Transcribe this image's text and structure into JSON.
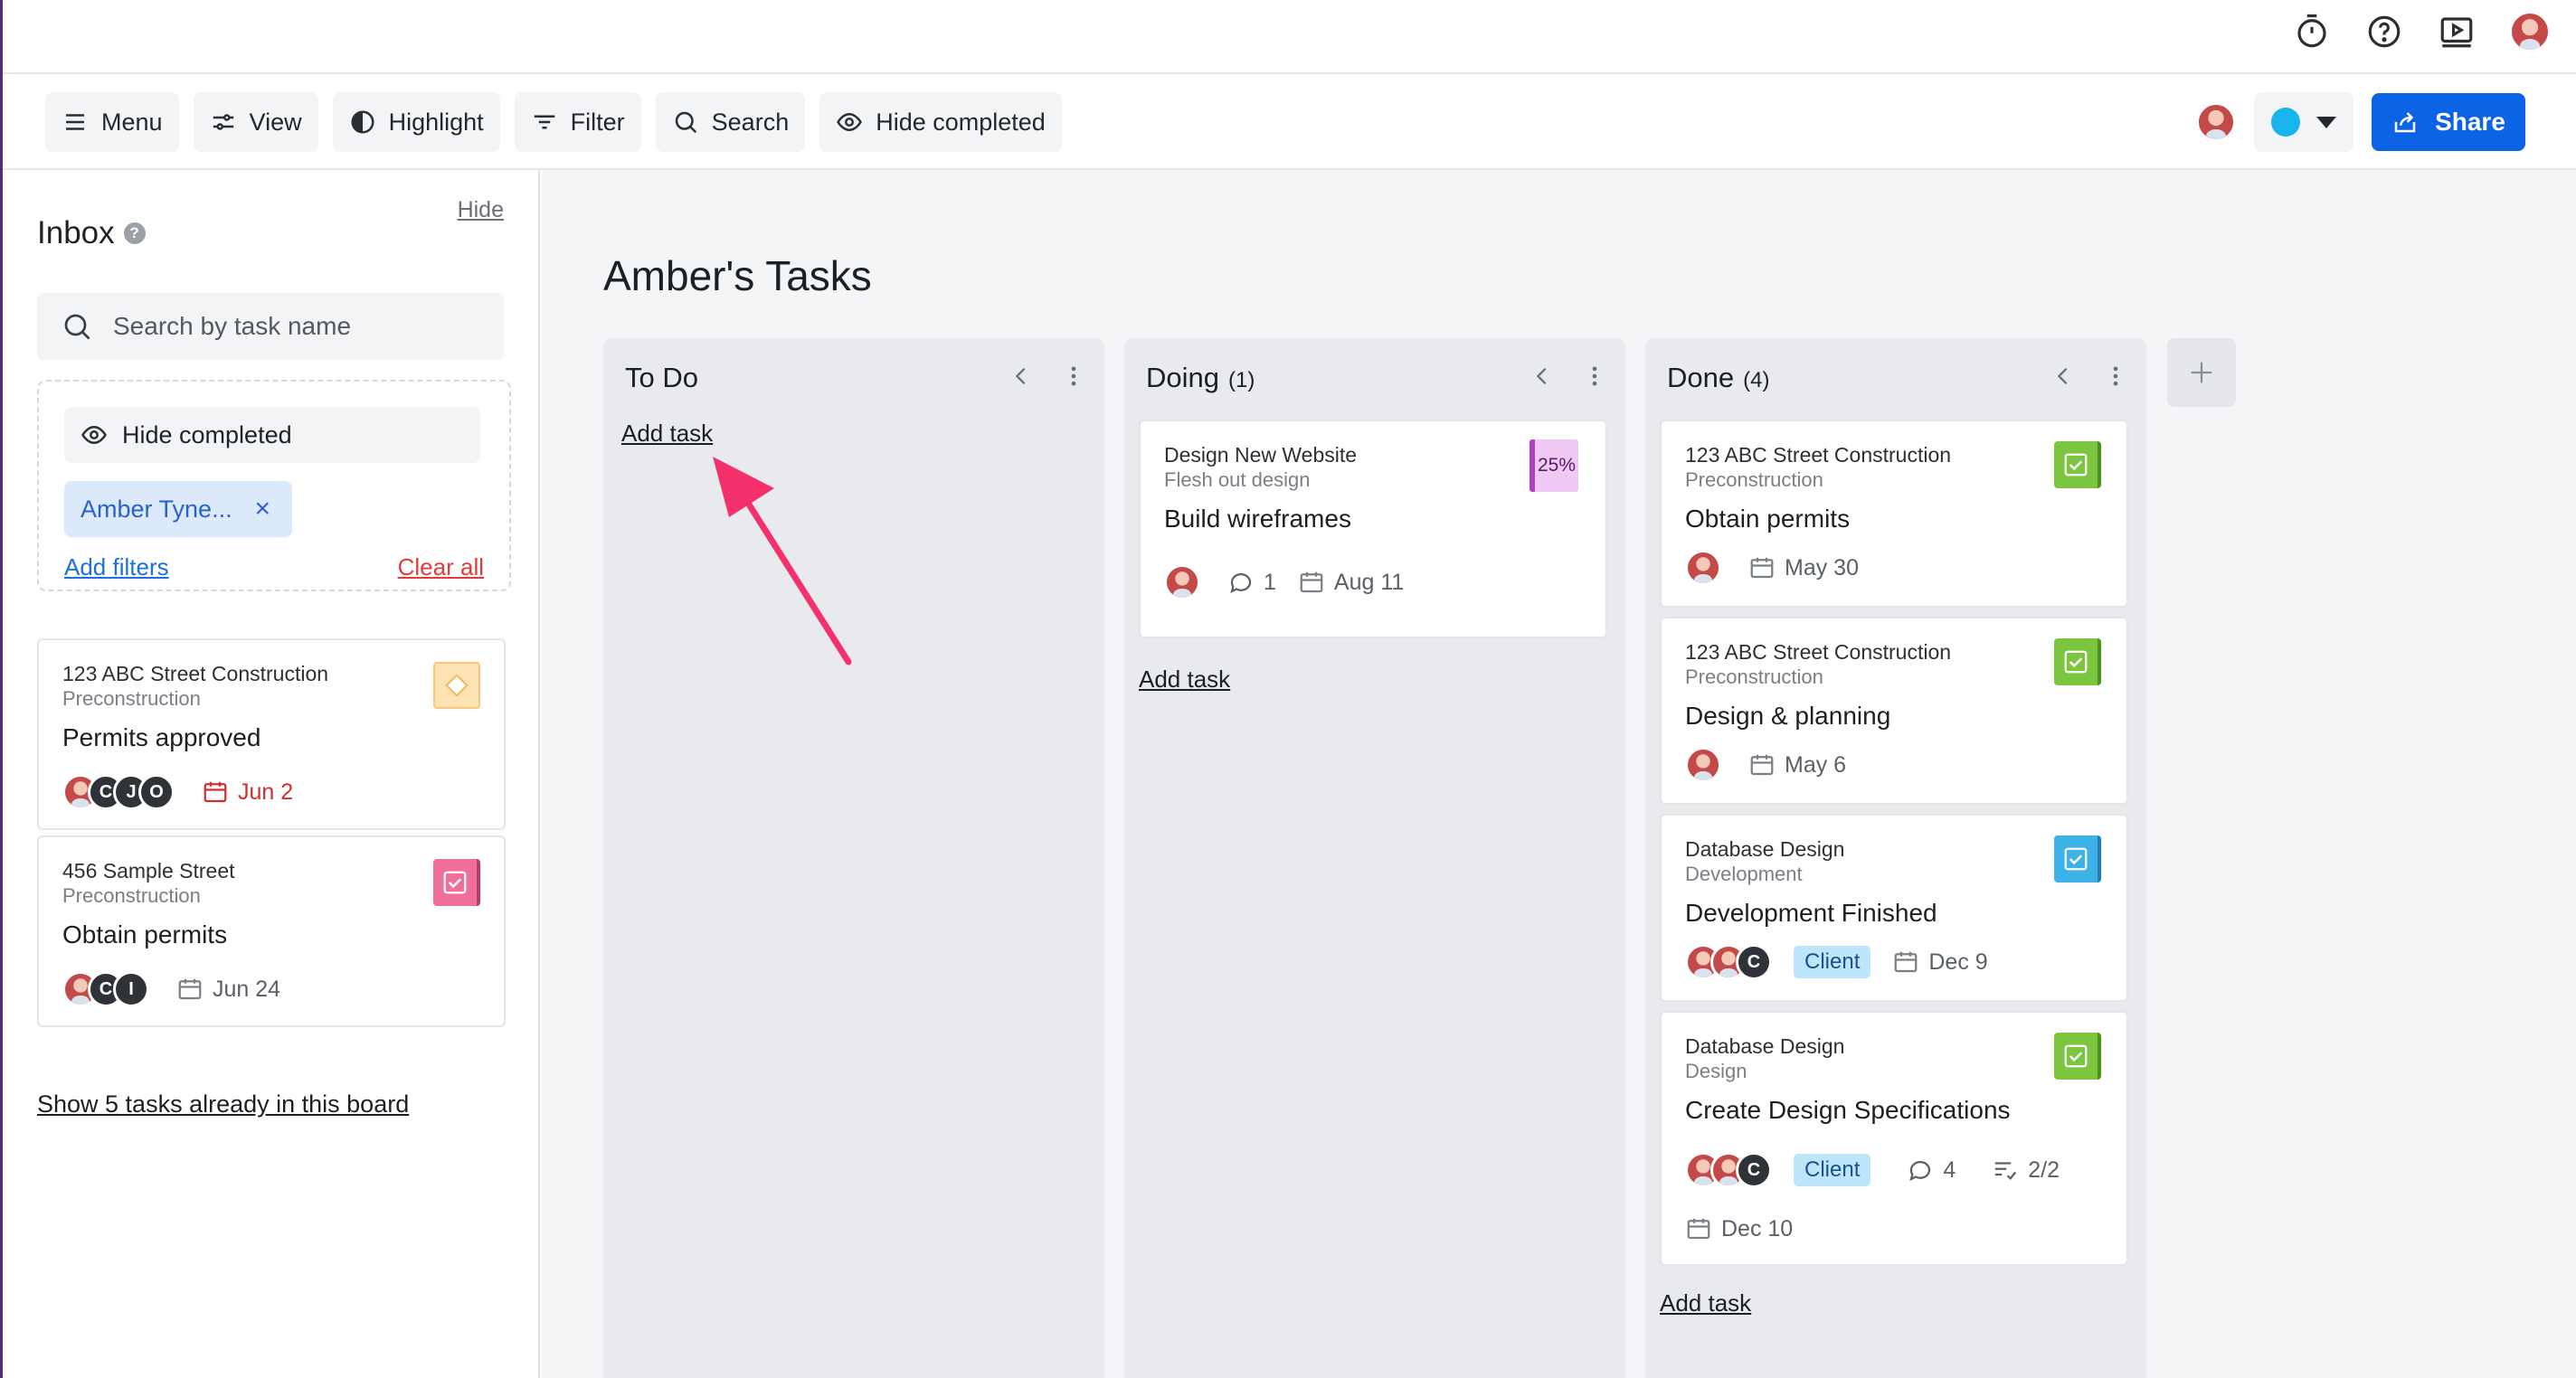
{
  "toolbar": {
    "menu": "Menu",
    "view": "View",
    "highlight": "Highlight",
    "filter": "Filter",
    "search": "Search",
    "hide_completed": "Hide completed",
    "share": "Share",
    "color_accent": "#18b4ee"
  },
  "sidebar": {
    "title": "Inbox",
    "help": "?",
    "hide": "Hide",
    "search_placeholder": "Search by task name",
    "hide_completed": "Hide completed",
    "filter_chip": "Amber Tyne...",
    "chip_close": "×",
    "add_filters": "Add filters",
    "clear_all": "Clear all",
    "cards": [
      {
        "project": "123 ABC Street Construction",
        "phase": "Preconstruction",
        "title": "Permits approved",
        "avatars": [
          "C",
          "J",
          "O"
        ],
        "date": "Jun 2",
        "date_color": "#d12f2f",
        "status": "milestone",
        "status_color": "#f8c97a"
      },
      {
        "project": "456 Sample Street",
        "phase": "Preconstruction",
        "title": "Obtain permits",
        "avatars": [
          "C",
          "I"
        ],
        "date": "Jun 24",
        "status": "checked",
        "status_color": "#ee6f9c"
      }
    ],
    "show_tasks": "Show 5 tasks already in this board"
  },
  "board": {
    "title": "Amber's Tasks",
    "columns": [
      {
        "name": "To Do",
        "count": "",
        "add_task": "Add task"
      },
      {
        "name": "Doing",
        "count": "(1)",
        "add_task": "Add task",
        "cards": [
          {
            "project": "Design New Website",
            "phase": "Flesh out design",
            "title": "Build wireframes",
            "progress": "25%",
            "comments": "1",
            "date": "Aug 11"
          }
        ]
      },
      {
        "name": "Done",
        "count": "(4)",
        "add_task": "Add task",
        "cards": [
          {
            "project": "123 ABC Street Construction",
            "phase": "Preconstruction",
            "title": "Obtain permits",
            "date": "May 30",
            "status_color": "#7cc63f"
          },
          {
            "project": "123 ABC Street Construction",
            "phase": "Preconstruction",
            "title": "Design & planning",
            "date": "May 6",
            "status_color": "#7cc63f"
          },
          {
            "project": "Database Design",
            "phase": "Development",
            "title": "Development Finished",
            "avatar_letter": "C",
            "tag": "Client",
            "date": "Dec 9",
            "status_color": "#3db2e8"
          },
          {
            "project": "Database Design",
            "phase": "Design",
            "title": "Create Design Specifications",
            "avatar_letter": "C",
            "tag": "Client",
            "comments": "4",
            "checklist": "2/2",
            "date": "Dec 10",
            "status_color": "#7cc63f"
          }
        ]
      }
    ]
  }
}
